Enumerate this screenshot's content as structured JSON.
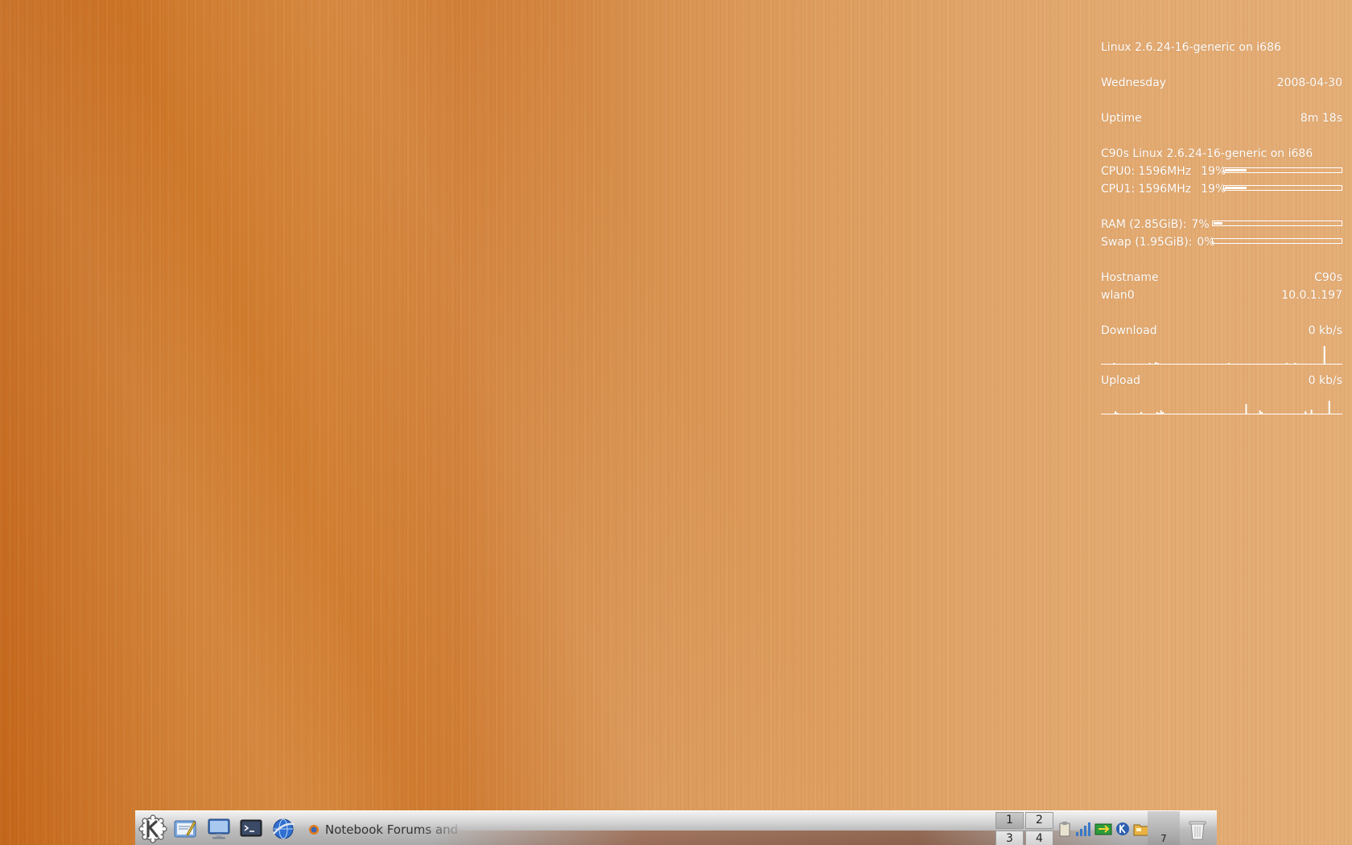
{
  "conky": {
    "system_line": "Linux 2.6.24-16-generic on i686",
    "day": "Wednesday",
    "date": "2008-04-30",
    "uptime_label": "Uptime",
    "uptime_value": "8m 18s",
    "host_line": "C90s Linux 2.6.24-16-generic on i686",
    "cpu0_label": "CPU0: 1596MHz",
    "cpu0_percent": "19%",
    "cpu0_fraction": 0.19,
    "cpu1_label": "CPU1: 1596MHz",
    "cpu1_percent": "19%",
    "cpu1_fraction": 0.19,
    "ram_label": "RAM (2.85GiB):",
    "ram_percent": "7%",
    "ram_fraction": 0.07,
    "swap_label": "Swap (1.95GiB):",
    "swap_percent": "0%",
    "swap_fraction": 0.0,
    "hostname_label": "Hostname",
    "hostname_value": "C90s",
    "iface_label": "wlan0",
    "iface_value": "10.0.1.197",
    "download_label": "Download",
    "download_value": "0 kb/s",
    "download_graph": [
      0,
      0,
      0,
      0,
      0,
      0,
      1,
      0,
      0,
      0,
      0,
      0,
      0,
      0,
      0,
      0,
      0,
      0,
      0,
      0,
      0,
      0,
      0,
      1,
      0,
      0,
      2,
      1,
      0,
      0,
      0,
      0,
      0,
      0,
      0,
      0,
      0,
      0,
      0,
      0,
      0,
      0,
      0,
      0,
      0,
      0,
      0,
      0,
      0,
      0,
      0,
      0,
      0,
      0,
      0,
      0,
      0,
      0,
      0,
      0,
      0,
      1,
      0,
      0,
      0,
      0,
      0,
      0,
      0,
      0,
      0,
      0,
      0,
      0,
      0,
      0,
      0,
      0,
      0,
      0,
      0,
      0,
      0,
      0,
      0,
      0,
      0,
      0,
      0,
      1,
      0,
      0,
      0,
      1,
      0,
      0,
      0,
      0,
      0,
      0,
      0,
      0,
      0,
      0,
      0,
      0,
      0,
      22,
      0,
      0,
      0,
      0,
      0,
      0,
      0,
      0
    ],
    "upload_label": "Upload",
    "upload_value": "0 kb/s",
    "upload_graph": [
      0,
      0,
      0,
      0,
      0,
      0,
      0,
      3,
      1,
      0,
      0,
      0,
      0,
      0,
      0,
      0,
      0,
      0,
      0,
      0,
      2,
      0,
      0,
      0,
      0,
      0,
      0,
      0,
      2,
      1,
      4,
      2,
      0,
      0,
      0,
      0,
      0,
      0,
      0,
      0,
      0,
      0,
      0,
      0,
      0,
      0,
      0,
      0,
      0,
      0,
      0,
      0,
      0,
      0,
      0,
      0,
      0,
      0,
      0,
      0,
      0,
      0,
      0,
      0,
      0,
      0,
      0,
      0,
      0,
      0,
      0,
      0,
      0,
      12,
      0,
      0,
      0,
      0,
      0,
      0,
      4,
      2,
      0,
      0,
      0,
      0,
      0,
      0,
      0,
      0,
      0,
      0,
      0,
      0,
      0,
      0,
      0,
      0,
      0,
      0,
      0,
      0,
      0,
      3,
      0,
      0,
      5,
      0,
      0,
      0,
      0,
      0,
      0,
      0,
      0,
      16,
      0,
      0,
      0,
      0,
      0,
      0
    ]
  },
  "panel": {
    "kmenu_icon": "kde-k-icon",
    "quicklaunch": [
      {
        "name": "text-editor-icon"
      },
      {
        "name": "monitor-icon"
      },
      {
        "name": "terminal-icon"
      },
      {
        "name": "browser-globe-icon"
      }
    ],
    "task_label": "Notebook Forums and",
    "pager": [
      "1",
      "2",
      "3",
      "4"
    ],
    "clock_digit": "7",
    "colors": {
      "conky_text": "#ffffff",
      "wood_dark": "#c4661a",
      "wood_light": "#e4ae77"
    }
  }
}
